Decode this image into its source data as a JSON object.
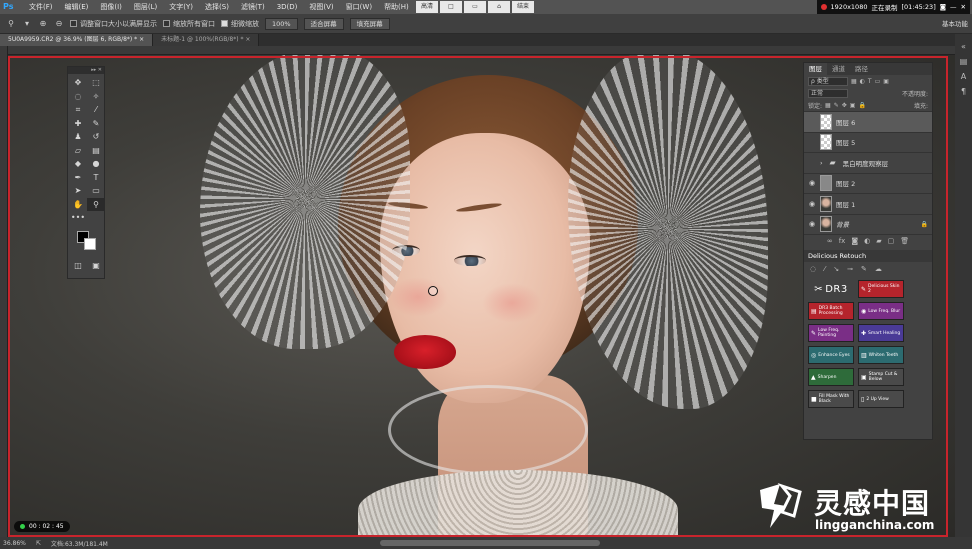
{
  "menubar": {
    "logo": "Ps",
    "items": [
      "文件(F)",
      "编辑(E)",
      "图像(I)",
      "图层(L)",
      "文字(Y)",
      "选择(S)",
      "滤镜(T)",
      "3D(D)",
      "视图(V)",
      "窗口(W)",
      "帮助(H)"
    ],
    "center_tools": [
      "高清",
      "□",
      "▭",
      "⌂",
      "结束"
    ],
    "status": {
      "resolution": "1920x1080",
      "recording": "正在录制",
      "timer": "[01:45:23]"
    }
  },
  "options": {
    "resize_window": "调整窗口大小以满屏显示",
    "zoom_all": "缩放所有窗口",
    "scrubby_zoom": "细微缩放",
    "zoom_value": "100%",
    "fit_screen": "适合屏幕",
    "fill_screen": "填充屏幕",
    "workspace": "基本功能"
  },
  "tabs": [
    {
      "label": "5U0A9959.CR2 @ 36.9% (图层 6, RGB/8*) *",
      "close": "×"
    },
    {
      "label": "未标题-1 @ 100%(RGB/8*) *",
      "close": "×"
    }
  ],
  "timer": "00 : 02 : 45",
  "statusbar": {
    "zoom": "36.86%",
    "doc": "文档:63.3M/181.4M"
  },
  "layers_panel": {
    "tabs": [
      "图层",
      "通道",
      "路径"
    ],
    "kind": "ρ 类型",
    "blend": "正常",
    "opacity_label": "不透明度:",
    "lock_label": "锁定:",
    "fill_label": "填充:",
    "layers": [
      {
        "name": "图层 6",
        "visible": false,
        "thumb": "checker",
        "selected": true
      },
      {
        "name": "图层 5",
        "visible": false,
        "thumb": "checker",
        "selected": false
      },
      {
        "name": "黑白明度观察层",
        "visible": false,
        "thumb": "folder",
        "selected": false
      },
      {
        "name": "图层 2",
        "visible": true,
        "thumb": "gray",
        "selected": false
      },
      {
        "name": "图层 1",
        "visible": true,
        "thumb": "photo",
        "selected": false
      },
      {
        "name": "背景",
        "visible": true,
        "thumb": "photo",
        "selected": false,
        "locked": true
      }
    ]
  },
  "plugin": {
    "title": "Delicious Retouch",
    "logo": "DR3",
    "buttons": [
      {
        "label": "Delicious Skin 2",
        "color": "#b5242c",
        "icon": "✎"
      },
      {
        "label": "DR3 Batch Processing",
        "color": "#b5242c",
        "icon": "▤"
      },
      {
        "label": "Low Freq. Blur",
        "color": "#7a2e86",
        "icon": "◉"
      },
      {
        "label": "Low Freq. Painting",
        "color": "#7a2e86",
        "icon": "✎"
      },
      {
        "label": "Smart Healing",
        "color": "#4a3a96",
        "icon": "✚"
      },
      {
        "label": "Enhance Eyes",
        "color": "#2c6b70",
        "icon": "◎"
      },
      {
        "label": "Whiten Teeth",
        "color": "#2c6b70",
        "icon": "▥"
      },
      {
        "label": "Sharpen",
        "color": "#2e6b3a",
        "icon": "▲"
      },
      {
        "label": "Stamp Cut & Below",
        "color": "#4a4a4a",
        "icon": "▣"
      },
      {
        "label": "Fill Mask With Black",
        "color": "#4a4a4a",
        "icon": "■"
      },
      {
        "label": "2 Up View",
        "color": "#4a4a4a",
        "icon": "▯"
      }
    ]
  },
  "watermark": {
    "cn": "灵感中国",
    "en": "lingganchina.com"
  }
}
